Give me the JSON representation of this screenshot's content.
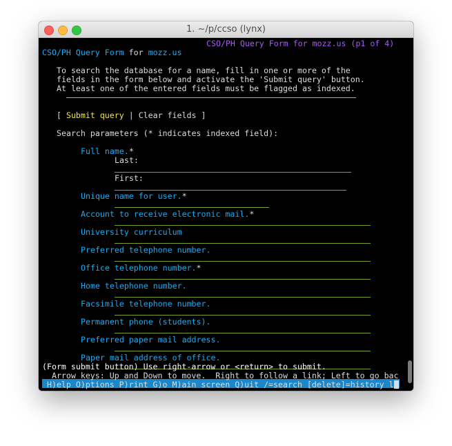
{
  "window": {
    "title": "1. ~/p/ccso (lynx)"
  },
  "header": {
    "top_right": "CSO/PH Query Form for mozz.us (p1 of 4)",
    "form_title": "CSO/PH Query Form",
    "for_word": "for",
    "host": "mozz.us"
  },
  "intro": {
    "line1": "To search the database for a name, fill in one or more of the",
    "line2": "fields in the form below and activate the 'Submit query' button.",
    "line3": "At least one of the entered fields must be flagged as indexed."
  },
  "actions": {
    "open_bracket": "[",
    "submit": "Submit query",
    "separator": "|",
    "clear": "Clear fields",
    "close_bracket": "]"
  },
  "search_params_label": "Search parameters (* indicates indexed field):",
  "fields": {
    "full_name": "Full name.",
    "full_name_star": "*",
    "last": "Last:",
    "first": "First:",
    "unique_name": "Unique name for user.",
    "unique_name_star": "*",
    "email": "Account to receive electronic mail.",
    "email_star": "*",
    "curriculum": "University curriculum",
    "pref_phone": "Preferred telephone number.",
    "office_phone": "Office telephone number.",
    "office_phone_star": "*",
    "home_phone": "Home telephone number.",
    "fax": "Facsimile telephone number.",
    "perm_phone": "Permanent phone (students).",
    "pref_mail": "Preferred paper mail address.",
    "office_mail": "Paper mail address of office."
  },
  "status": {
    "highlight": "(Form submit button) Use right-arrow or <return> to submit.",
    "keys_line": "  Arrow keys: Up and Down to move.  Right to follow a link; Left to go bac",
    "help_line": " H)elp O)ptions P)rint G)o M)ain screen Q)uit /=search [delete]=history l"
  },
  "colors": {
    "title_purple": "#a35cf0",
    "link_cyan": "#1eaaf1",
    "submit_yellow": "#f3e34a",
    "field_green": "#7a9f2a",
    "status_blue": "#1b86c9"
  }
}
